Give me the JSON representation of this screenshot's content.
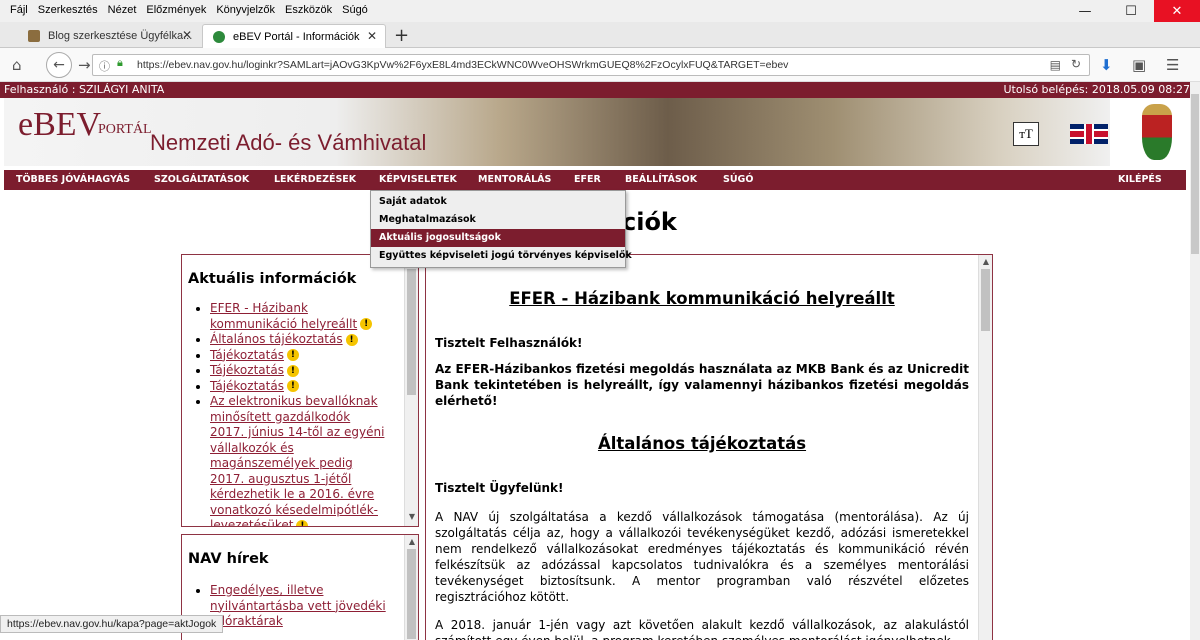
{
  "browser": {
    "menu": [
      "Fájl",
      "Szerkesztés",
      "Nézet",
      "Előzmények",
      "Könyvjelzők",
      "Eszközök",
      "Súgó"
    ],
    "tabs": [
      {
        "title": "Blog szerkesztése Ügyfélka..."
      },
      {
        "title": "eBEV Portál - Információk"
      }
    ],
    "url": "https://ebev.nav.gov.hu/loginkr?SAMLart=jAOvG3KpVw%2F6yxE8L4md3ECkWNC0WveOHSWrkmGUEQ8%2FzOcylxFUQ&TARGET=ebev",
    "status_url": "https://ebev.nav.gov.hu/kapa?page=aktJogok"
  },
  "user_bar": {
    "user": "Felhasználó : SZILÁGYI ANITA",
    "last_login": "Utolsó belépés: 2018.05.09 08:27"
  },
  "header": {
    "logo": "eBEV",
    "logo_sub": "PORTÁL",
    "org": "Nemzeti Adó- és Vámhivatal",
    "font_btn": "ᴛT"
  },
  "nav": {
    "items": [
      "TÖBBES JÓVÁHAGYÁS",
      "SZOLGÁLTATÁSOK",
      "LEKÉRDEZÉSEK",
      "KÉPVISELETEK",
      "MENTORÁLÁS",
      "EFER",
      "BEÁLLÍTÁSOK",
      "SÚGÓ"
    ],
    "logout": "KILÉPÉS"
  },
  "dropdown": {
    "items": [
      "Saját adatok",
      "Meghatalmazások",
      "Aktuális jogosultságok",
      "Együttes képviseleti jogú törvényes képviselők"
    ],
    "selected_index": 2
  },
  "page_title": "Információk",
  "aktualis": {
    "title": "Aktuális információk",
    "items": [
      {
        "text": "EFER - Házibank kommunikáció helyreállt"
      },
      {
        "text": "Általános tájékoztatás"
      },
      {
        "text": "Tájékoztatás"
      },
      {
        "text": "Tájékoztatás"
      },
      {
        "text": "Tájékoztatás"
      },
      {
        "text": "Az elektronikus bevallóknak minősített gazdálkodók 2017. június 14-től az egyéni vállalkozók és magánszemélyek pedig 2017. augusztus 1-jétől kérdezhetik le a 2016. évre vonatkozó késedelmipótlék-levezetésüket"
      }
    ]
  },
  "nav_hirek": {
    "title": "NAV hírek",
    "items": [
      {
        "text": "Engedélyes, illetve nyilvántartásba vett jövedéki adóraktárak"
      }
    ]
  },
  "content": {
    "h1": "EFER - Házibank kommunikáció helyreállt",
    "p1": "Tisztelt Felhasználók!",
    "p2": "Az EFER-Házibankos fizetési megoldás használata az MKB Bank és az Unicredit Bank tekintetében is helyreállt, így valamennyi házibankos fizetési megoldás elérhető!",
    "h2": "Általános tájékoztatás",
    "p3": "Tisztelt Ügyfelünk!",
    "p4": "A NAV új szolgáltatása a kezdő vállalkozások támogatása (mentorálása). Az új szolgáltatás célja az, hogy a vállalkozói tevékenységüket kezdő, adózási ismeretekkel nem rendelkező vállalkozásokat eredményes tájékoztatás és kommunikáció révén felkészítsük az adózással kapcsolatos tudnivalókra és a személyes mentorálási tevékenységet biztosítsunk. A mentor programban való részvétel előzetes regisztrációhoz kötött.",
    "p5": "A 2018. január 1-jén vagy azt követően alakult kezdő vállalkozások, az alakulástól számított egy éven belül, a program keretében személyes mentorálást igényelhetnek."
  },
  "colors": {
    "accent": "#7c1d2e",
    "link": "#8e1f35",
    "warning": "#f5c400"
  }
}
